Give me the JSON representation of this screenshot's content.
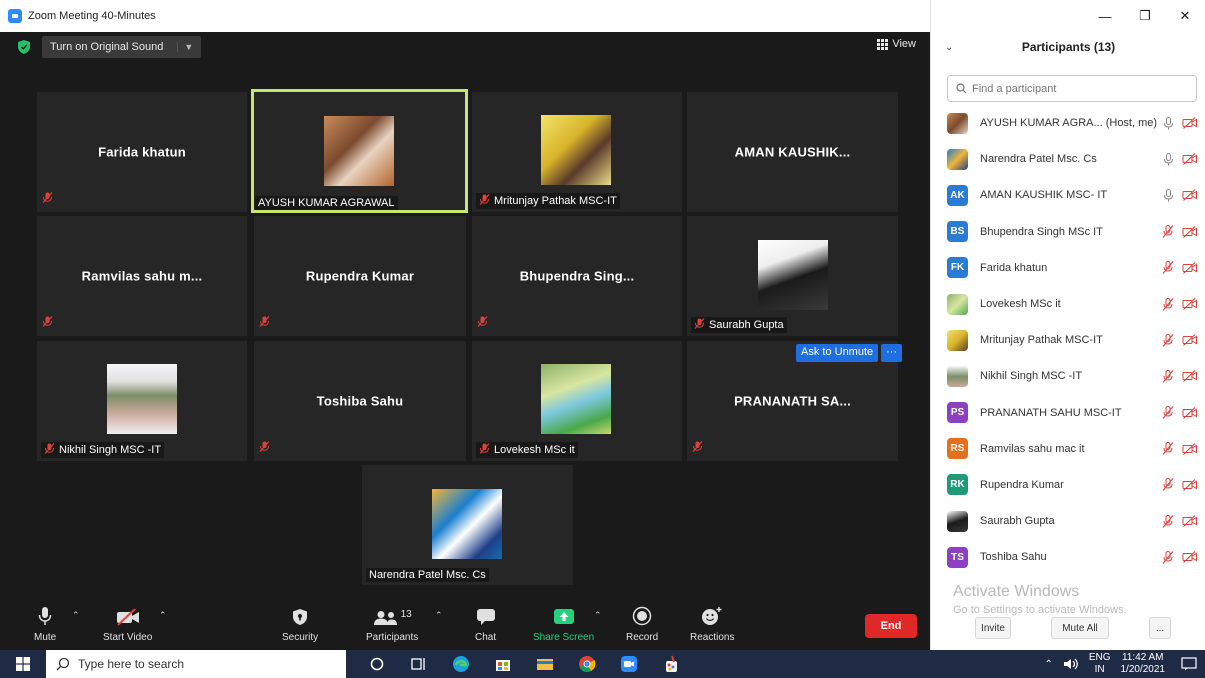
{
  "window": {
    "title": "Zoom Meeting 40-Minutes"
  },
  "meeting_topbar": {
    "original_sound_label": "Turn on Original Sound",
    "view_label": "View"
  },
  "tiles": {
    "farida": {
      "name": "Farida khatun"
    },
    "ayush": {
      "label": "AYUSH KUMAR AGRAWAL"
    },
    "mritunjay": {
      "label": "Mritunjay Pathak MSC-IT"
    },
    "aman": {
      "name": "AMAN  KAUSHIK..."
    },
    "ramvilas": {
      "name": "Ramvilas sahu m..."
    },
    "rupendra": {
      "name": "Rupendra Kumar"
    },
    "bhupendra": {
      "name": "Bhupendra  Sing..."
    },
    "saurabh": {
      "label": "Saurabh Gupta"
    },
    "nikhil": {
      "label": "Nikhil Singh MSC -IT"
    },
    "toshiba": {
      "name": "Toshiba Sahu"
    },
    "lovekesh": {
      "label": "Lovekesh MSc it"
    },
    "pranabath": {
      "name": "PRANANATH  SA..."
    },
    "narendra": {
      "label": "Narendra Patel Msc. Cs"
    }
  },
  "ask_unmute": {
    "label": "Ask to Unmute",
    "more": "···"
  },
  "toolbar": {
    "mute": "Mute",
    "start_video": "Start Video",
    "security": "Security",
    "participants": "Participants",
    "participants_count": "13",
    "chat": "Chat",
    "share_screen": "Share Screen",
    "record": "Record",
    "reactions": "Reactions",
    "end": "End"
  },
  "panel": {
    "title": "Participants (13)",
    "search_placeholder": "Find a participant",
    "participants": [
      {
        "name": "AYUSH KUMAR AGRA...  (Host, me)",
        "initials": "",
        "color": "",
        "mic": "on"
      },
      {
        "name": "Narendra Patel Msc. Cs",
        "initials": "",
        "color": "",
        "mic": "on"
      },
      {
        "name": "AMAN KAUSHIK MSC- IT",
        "initials": "AK",
        "color": "#2b7bd3",
        "mic": "on"
      },
      {
        "name": "Bhupendra Singh MSc IT",
        "initials": "BS",
        "color": "#2b7bd3",
        "mic": "muted"
      },
      {
        "name": "Farida khatun",
        "initials": "FK",
        "color": "#2b7bd3",
        "mic": "muted"
      },
      {
        "name": "Lovekesh MSc it",
        "initials": "",
        "color": "",
        "mic": "muted"
      },
      {
        "name": "Mritunjay Pathak MSC-IT",
        "initials": "",
        "color": "",
        "mic": "muted"
      },
      {
        "name": "Nikhil Singh MSC -IT",
        "initials": "",
        "color": "",
        "mic": "muted"
      },
      {
        "name": "PRANANATH SAHU MSC-IT",
        "initials": "PS",
        "color": "#8e3fc2",
        "mic": "muted"
      },
      {
        "name": "Ramvilas sahu mac it",
        "initials": "RS",
        "color": "#e2701c",
        "mic": "muted"
      },
      {
        "name": "Rupendra Kumar",
        "initials": "RK",
        "color": "#1e9a78",
        "mic": "muted"
      },
      {
        "name": "Saurabh Gupta",
        "initials": "",
        "color": "",
        "mic": "muted"
      },
      {
        "name": "Toshiba Sahu",
        "initials": "TS",
        "color": "#8e3fc2",
        "mic": "muted"
      }
    ],
    "invite": "Invite",
    "mute_all": "Mute All",
    "more": "...",
    "watermark_title": "Activate Windows",
    "watermark_sub": "Go to Settings to activate Windows."
  },
  "taskbar": {
    "search_placeholder": "Type here to search",
    "lang_top": "ENG",
    "lang_bottom": "IN",
    "time": "11:42 AM",
    "date": "1/20/2021"
  },
  "colors": {
    "active_speaker": "#c5e86c",
    "end": "#e02828",
    "share_green": "#26d07c",
    "mute_red": "#e0403a"
  }
}
